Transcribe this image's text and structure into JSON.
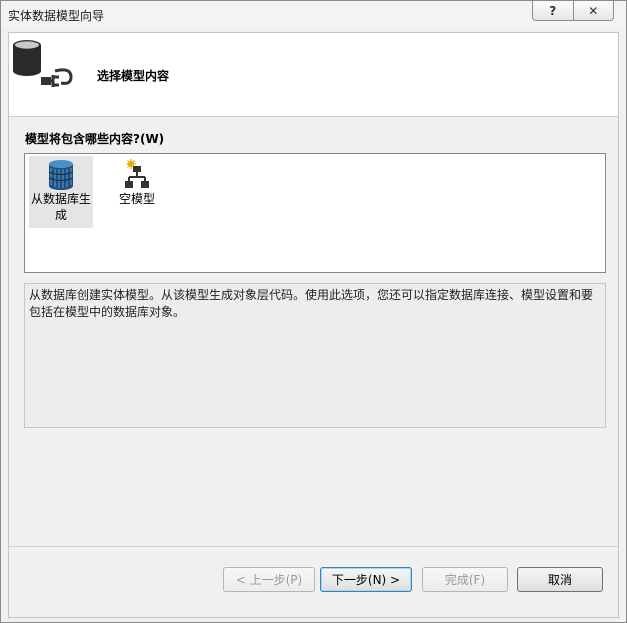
{
  "window": {
    "title": "实体数据模型向导",
    "help_glyph": "?",
    "close_glyph": "✕"
  },
  "header": {
    "title": "选择模型内容"
  },
  "question": "模型将包含哪些内容?(W)",
  "options": [
    {
      "label_line1": "从数据库生",
      "label_line2": "成",
      "icon": "database-icon",
      "selected": true
    },
    {
      "label_line1": "空模型",
      "icon": "empty-model-icon",
      "selected": false
    }
  ],
  "description": "从数据库创建实体模型。从该模型生成对象层代码。使用此选项，您还可以指定数据库连接、模型设置和要包括在模型中的数据库对象。",
  "buttons": {
    "back": "< 上一步(P)",
    "next": "下一步(N) >",
    "finish": "完成(F)",
    "cancel": "取消"
  }
}
